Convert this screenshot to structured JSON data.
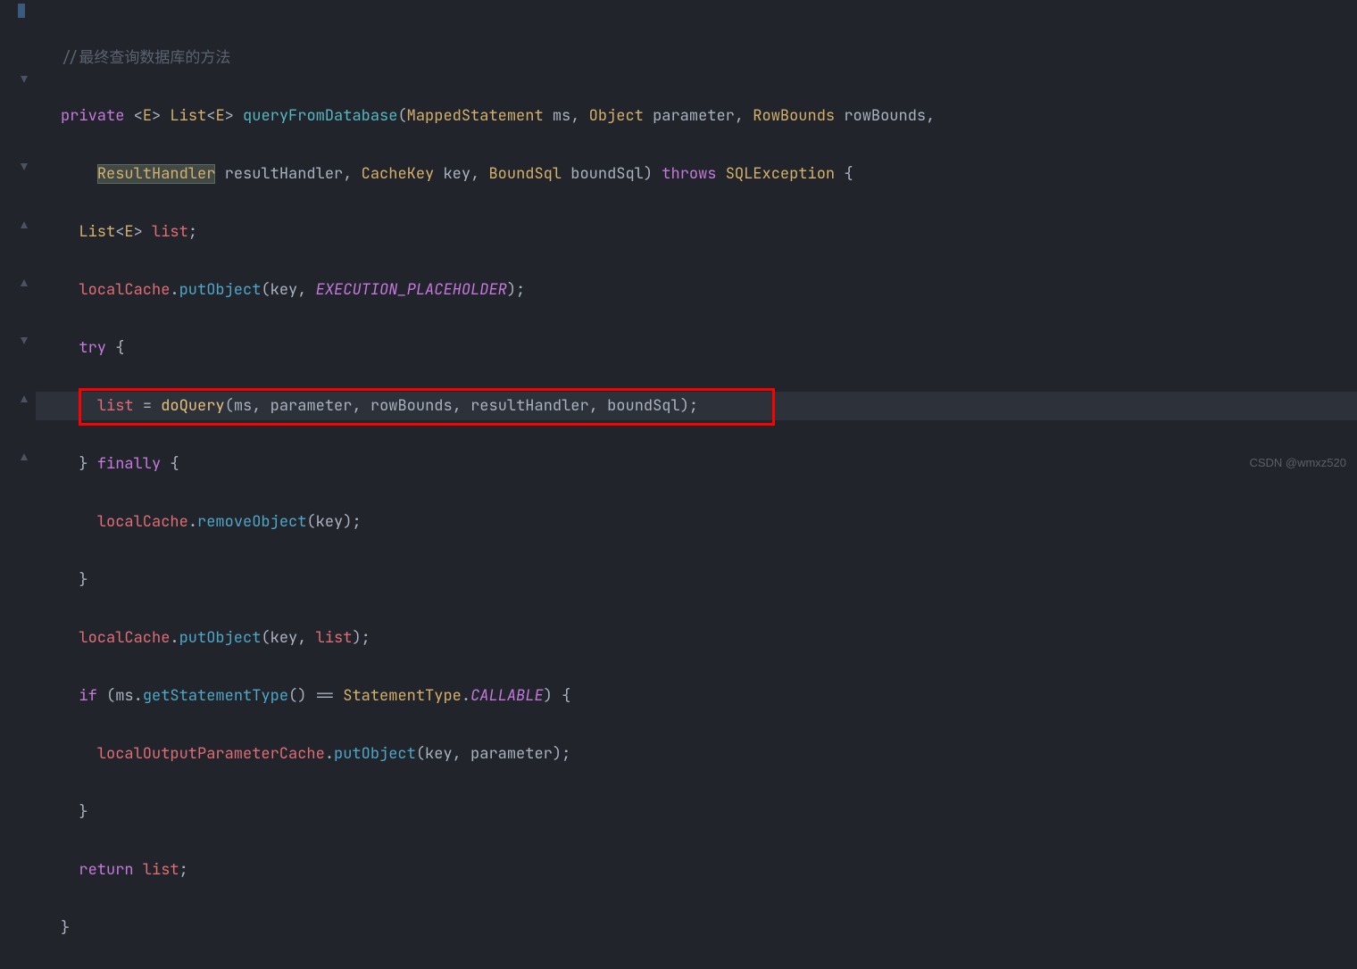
{
  "watermark": "CSDN @wmxz520",
  "code": {
    "comment": "//最终查询数据库的方法",
    "kw_private": "private",
    "generic_open": "<",
    "generic_E": "E",
    "generic_close": ">",
    "type_List": "List",
    "type_List2_open": "<",
    "type_List2_close": ">",
    "method_name": "queryFromDatabase",
    "lp": "(",
    "rp": ")",
    "type_MappedStatement": "MappedStatement",
    "p_ms": "ms",
    "type_Object": "Object",
    "p_parameter": "parameter",
    "type_RowBounds": "RowBounds",
    "p_rowBounds": "rowBounds",
    "type_ResultHandler": "ResultHandler",
    "p_resultHandler": "resultHandler",
    "type_CacheKey": "CacheKey",
    "p_key": "key",
    "type_BoundSql": "BoundSql",
    "p_boundSql": "boundSql",
    "kw_throws": "throws",
    "type_SQLException": "SQLException",
    "brace_open": "{",
    "brace_close": "}",
    "v_list": "list",
    "semi": ";",
    "f_localCache": "localCache",
    "dot": ".",
    "m_putObject": "putObject",
    "a_key": "key",
    "const_placeholder": "EXECUTION_PLACEHOLDER",
    "kw_try": "try",
    "m_doQuery": "doQuery",
    "a_ms": "ms",
    "a_parameter": "parameter",
    "a_rowBounds": "rowBounds",
    "a_resultHandler": "resultHandler",
    "a_boundSql": "boundSql",
    "kw_finally": "finally",
    "m_removeObject": "removeObject",
    "a_list": "list",
    "kw_if": "if",
    "m_getStatementType": "getStatementType",
    "eqop": "==",
    "type_StatementType": "StatementType",
    "const_CALLABLE": "CALLABLE",
    "f_localOutputParameterCache": "localOutputParameterCache",
    "kw_return": "return",
    "comma": ",",
    "space": " ",
    "assign": " = "
  }
}
